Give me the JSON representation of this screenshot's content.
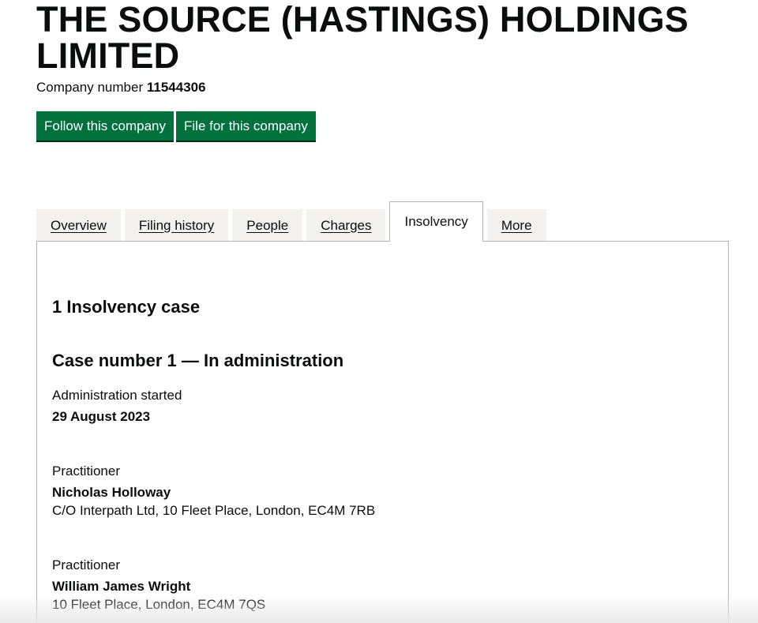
{
  "company": {
    "name": "THE SOURCE (HASTINGS) HOLDINGS LIMITED",
    "number_label": "Company number",
    "number": "11544306"
  },
  "actions": {
    "follow_label": "Follow this company",
    "file_label": "File for this company"
  },
  "tabs": [
    {
      "label": "Overview",
      "active": false
    },
    {
      "label": "Filing history",
      "active": false
    },
    {
      "label": "People",
      "active": false
    },
    {
      "label": "Charges",
      "active": false
    },
    {
      "label": "Insolvency",
      "active": true
    },
    {
      "label": "More",
      "active": false
    }
  ],
  "insolvency": {
    "count_heading": "1 Insolvency case",
    "case_heading": "Case number 1 — In administration",
    "started_label": "Administration started",
    "started_date": "29 August 2023",
    "practitioners": [
      {
        "label": "Practitioner",
        "name": "Nicholas Holloway",
        "address": "C/O Interpath Ltd, 10 Fleet Place, London, EC4M 7RB"
      },
      {
        "label": "Practitioner",
        "name": "William James Wright",
        "address": "10 Fleet Place, London, EC4M 7QS"
      }
    ]
  },
  "colors": {
    "button_green": "#00703c",
    "tab_inactive_bg": "#f3f2f1",
    "border_grey": "#b1b4b6",
    "text": "#0b0c0c"
  }
}
